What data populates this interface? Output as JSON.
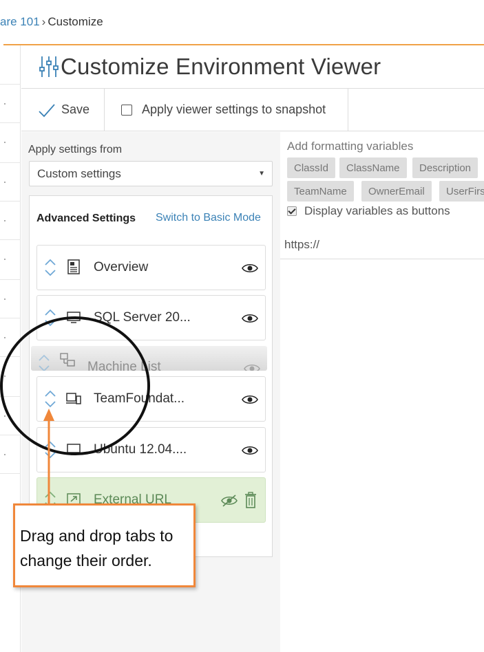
{
  "breadcrumb": {
    "parent": "are 101",
    "separator": "›",
    "current": "Customize"
  },
  "page": {
    "title": "Customize Environment Viewer"
  },
  "toolbar": {
    "save_label": "Save",
    "snapshot_label": "Apply viewer settings to snapshot",
    "snapshot_checked": false
  },
  "settings": {
    "apply_from_label": "Apply settings from",
    "apply_from_value": "Custom settings",
    "advanced_title": "Advanced Settings",
    "switch_mode_label": "Switch to Basic Mode"
  },
  "tabs": [
    {
      "label": "Overview",
      "icon": "document-icon",
      "visible": true
    },
    {
      "label": "SQL Server 20...",
      "icon": "monitor-icon",
      "visible": true
    },
    {
      "label": "Machine List",
      "icon": "network-icon",
      "visible": true,
      "state": "dragging"
    },
    {
      "label": "TeamFoundat...",
      "icon": "devices-icon",
      "visible": true
    },
    {
      "label": "Ubuntu 12.04....",
      "icon": "monitor-icon",
      "visible": true
    },
    {
      "label": "External URL",
      "icon": "external-link-icon",
      "visible": false,
      "deletable": true
    }
  ],
  "variables": {
    "title": "Add formatting variables",
    "chips_row1": [
      "ClassId",
      "ClassName",
      "Description"
    ],
    "chips_row2": [
      "TeamName",
      "OwnerEmail",
      "UserFirs"
    ],
    "display_as_buttons_label": "Display variables as buttons",
    "display_as_buttons_checked": true,
    "url_value": "https://"
  },
  "annotation": {
    "text": "Drag and drop tabs to change their order."
  },
  "colors": {
    "accent_orange": "#f0873a",
    "link_blue": "#3b82b6",
    "external_green": "#e2f0d6"
  }
}
